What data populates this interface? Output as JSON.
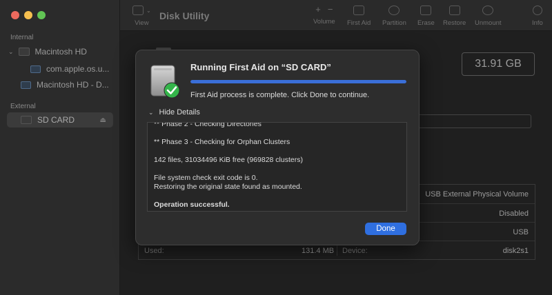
{
  "window": {
    "title": "Disk Utility"
  },
  "traffic_lights": {
    "close": "#ed6a5e",
    "minimize": "#f5bf4f",
    "zoom": "#61c454"
  },
  "sidebar": {
    "internal_label": "Internal",
    "external_label": "External",
    "internal_items": [
      {
        "label": "Macintosh HD",
        "icon": "disk-icon"
      },
      {
        "label": "com.apple.os.u...",
        "icon": "volume-icon"
      },
      {
        "label": "Macintosh HD - D...",
        "icon": "volume-icon"
      }
    ],
    "external_items": [
      {
        "label": "SD CARD",
        "icon": "disk-icon",
        "eject": "⏏"
      }
    ]
  },
  "toolbar": {
    "view_label": "View",
    "volume_label": "Volume",
    "first_aid_label": "First Aid",
    "partition_label": "Partition",
    "erase_label": "Erase",
    "restore_label": "Restore",
    "unmount_label": "Unmount",
    "info_label": "Info",
    "volume_plus": "+",
    "volume_minus": "−"
  },
  "main": {
    "capacity": "31.91 GB",
    "info_rows": [
      {
        "value": "USB External Physical Volume"
      },
      {
        "value": "Disabled"
      },
      {
        "value": "USB"
      }
    ],
    "used_label": "Used:",
    "used_value": "131.4 MB",
    "device_label": "Device:",
    "device_value": "disk2s1"
  },
  "dialog": {
    "title": "Running First Aid on “SD CARD”",
    "progress": 1.0,
    "status": "First Aid process is complete. Click Done to continue.",
    "details_toggle": "Hide Details",
    "log": {
      "line1": "** Phase 2 - Checking Directories",
      "line2": "** Phase 3 - Checking for Orphan Clusters",
      "line3": "142 files, 31034496 KiB free (969828 clusters)",
      "line4": "File system check exit code is 0.",
      "line5": "Restoring the original state found as mounted.",
      "line6": "Operation successful."
    },
    "done_label": "Done"
  },
  "colors": {
    "accent": "#2f6fe0",
    "progress": "#3a6fd8",
    "check": "#34b54a"
  }
}
